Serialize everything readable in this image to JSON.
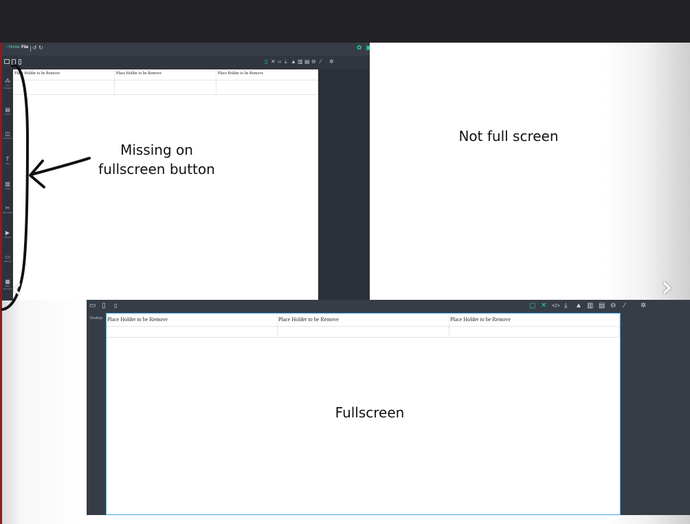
{
  "editor_small": {
    "topbar": {
      "home_label": "Home",
      "file_label": "File",
      "undo_icon": "undo-icon",
      "redo_icon": "redo-icon"
    },
    "sidebar": [
      {
        "label": "Site Manager",
        "icon": "sitemap-icon"
      },
      {
        "label": "Layout",
        "icon": "layout-icon"
      },
      {
        "label": "Containers",
        "icon": "container-icon"
      },
      {
        "label": "Text",
        "icon": "text-icon"
      },
      {
        "label": "Image",
        "icon": "image-icon"
      },
      {
        "label": "Decoration",
        "icon": "decoration-icon"
      },
      {
        "label": "Videos",
        "icon": "video-icon"
      },
      {
        "label": "Buttons",
        "icon": "button-icon"
      },
      {
        "label": "Basic Elements",
        "icon": "grid-icon"
      }
    ],
    "placeholders": [
      "Place Holder to be Remove",
      "Place Holder to be Remove",
      "Place Holder to be Remove"
    ]
  },
  "editor_full": {
    "device_label": "Desktop",
    "placeholders": [
      "Place Holder to be Remove",
      "Place Holder to be Remove",
      "Place Holder to be Remove"
    ]
  },
  "annotations": {
    "missing": "Missing on fullscreen button",
    "not_full": "Not full screen",
    "fullscreen": "Fullscreen"
  },
  "colors": {
    "accent": "#22d6a3",
    "panel": "#373d47",
    "canvas_border": "#3ea8e5",
    "ink": "#111111"
  }
}
